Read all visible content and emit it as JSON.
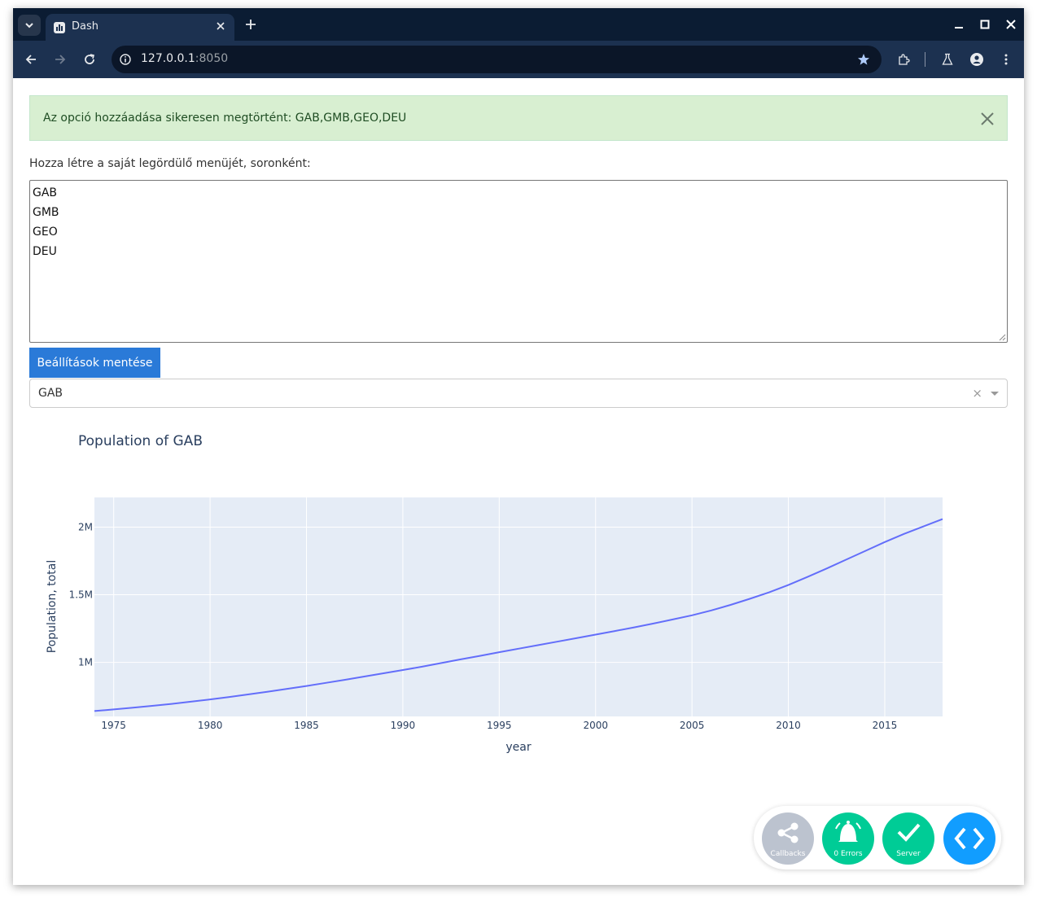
{
  "browser": {
    "tab_title": "Dash",
    "url_host": "127.0.0.1",
    "url_port": ":8050"
  },
  "alert": {
    "message": "Az opció hozzáadása sikeresen megtörtént: GAB,GMB,GEO,DEU"
  },
  "form": {
    "label": "Hozza létre a saját legördülő menüjét, soronként:",
    "textarea_lines": [
      "GAB",
      "GMB",
      "GEO",
      "DEU"
    ],
    "save_button": "Beállítások mentése",
    "dropdown_value": "GAB",
    "dropdown_clear": "×"
  },
  "colors": {
    "accent": "#2a7ad8",
    "alert_bg": "#d8efd1",
    "plot_bg": "#e5ecf6",
    "line": "#636efa"
  },
  "chart_data": {
    "type": "line",
    "title": "Population of GAB",
    "xlabel": "year",
    "ylabel": "Population, total",
    "xlim": [
      1974,
      2018
    ],
    "ylim": [
      600000,
      2220000
    ],
    "x_ticks": [
      1975,
      1980,
      1985,
      1990,
      1995,
      2000,
      2005,
      2010,
      2015
    ],
    "y_ticks": [
      1000000,
      1500000,
      2000000
    ],
    "y_tick_labels": [
      "1M",
      "1.5M",
      "2M"
    ],
    "grid": true,
    "series": [
      {
        "x": [
          1974,
          1975,
          1976,
          1977,
          1978,
          1979,
          1980,
          1981,
          1982,
          1983,
          1984,
          1985,
          1986,
          1987,
          1988,
          1989,
          1990,
          1991,
          1992,
          1993,
          1994,
          1995,
          1996,
          1997,
          1998,
          1999,
          2000,
          2001,
          2002,
          2003,
          2004,
          2005,
          2006,
          2007,
          2008,
          2009,
          2010,
          2011,
          2012,
          2013,
          2014,
          2015,
          2016,
          2017,
          2018
        ],
        "y": [
          640000,
          652000,
          665000,
          678000,
          693000,
          709000,
          726000,
          744000,
          763000,
          783000,
          804000,
          825000,
          848000,
          871000,
          895000,
          919000,
          943000,
          968000,
          995000,
          1022000,
          1048000,
          1075000,
          1101000,
          1127000,
          1153000,
          1179000,
          1205000,
          1232000,
          1259000,
          1287000,
          1317000,
          1348000,
          1384000,
          1425000,
          1470000,
          1518000,
          1572000,
          1632000,
          1695000,
          1760000,
          1825000,
          1890000,
          1950000,
          2005000,
          2060000
        ]
      }
    ]
  },
  "debug_menu": {
    "callbacks_label": "Callbacks",
    "errors_label": "0 Errors",
    "server_label": "Server"
  }
}
